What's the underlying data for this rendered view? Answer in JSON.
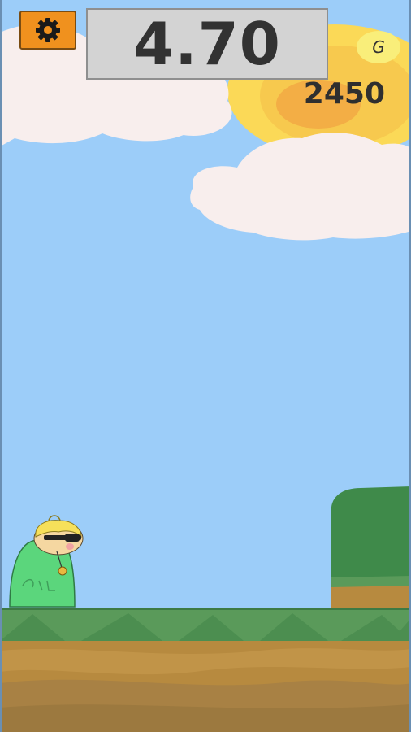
{
  "hud": {
    "timer": "4.70",
    "score": "2450",
    "currency_symbol": "G",
    "settings_icon": "gear-icon"
  },
  "character": {
    "shirt_text": "GAL"
  },
  "colors": {
    "sky": "#9ccdf9",
    "sun_outer": "#fbd957",
    "sun_inner": "#f3ae45",
    "cloud": "#f8eeed",
    "grass": "#5a9a5a",
    "dirt": "#b78a3f",
    "bush": "#3f8a4a",
    "settings_button": "#f0911e",
    "timer_box": "#d3d3d3",
    "character_body": "#5bd67c",
    "character_hair": "#f6e05a"
  }
}
